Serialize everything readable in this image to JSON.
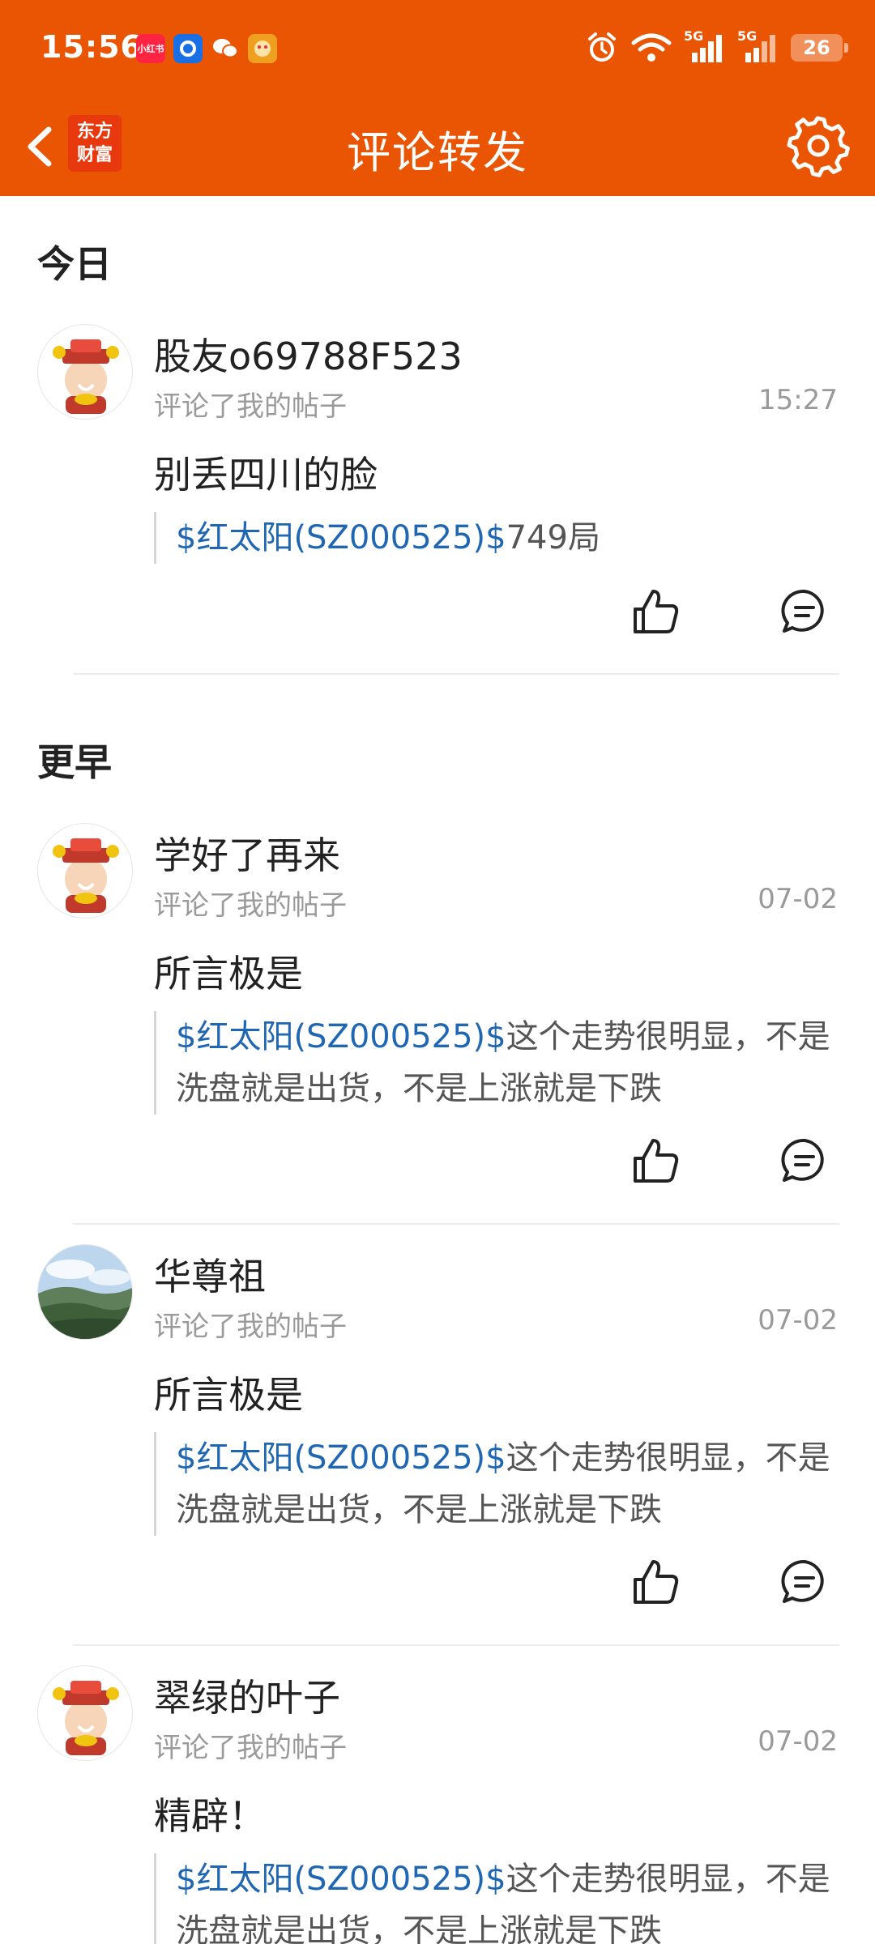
{
  "status_bar": {
    "time": "15:56",
    "apps": [
      {
        "name": "xiaohongshu-icon",
        "label": "小红书",
        "color": "#ff2442"
      },
      {
        "name": "browser-icon",
        "label": "",
        "color": "#1b6fe5"
      },
      {
        "name": "wechat-icon",
        "label": "",
        "color": "#ea5504"
      },
      {
        "name": "game-icon",
        "label": "",
        "color": "#f0a020"
      }
    ],
    "network_label_1": "5G",
    "network_label_2": "5G",
    "battery": "26"
  },
  "navbar": {
    "logo_line1": "东方",
    "logo_line2": "财富",
    "title": "评论转发"
  },
  "sections": {
    "today": "今日",
    "earlier": "更早"
  },
  "items": [
    {
      "username": "股友o69788F523",
      "action": "评论了我的帖子",
      "time": "15:27",
      "comment": "别丢四川的脸",
      "quote_tag": "$红太阳(SZ000525)$",
      "quote_text": "749局"
    },
    {
      "username": "学好了再来",
      "action": "评论了我的帖子",
      "time": "07-02",
      "comment": "所言极是",
      "quote_tag": "$红太阳(SZ000525)$",
      "quote_text": "这个走势很明显，不是洗盘就是出货，不是上涨就是下跌"
    },
    {
      "username": "华尊祖",
      "action": "评论了我的帖子",
      "time": "07-02",
      "comment": "所言极是",
      "quote_tag": "$红太阳(SZ000525)$",
      "quote_text": "这个走势很明显，不是洗盘就是出货，不是上涨就是下跌"
    },
    {
      "username": "翠绿的叶子",
      "action": "评论了我的帖子",
      "time": "07-02",
      "comment": "精辟！",
      "quote_tag": "$红太阳(SZ000525)$",
      "quote_text": "这个走势很明显，不是洗盘就是出货，不是上涨就是下跌"
    }
  ],
  "colors": {
    "brand": "#ea5504",
    "link": "#1f66b3"
  }
}
